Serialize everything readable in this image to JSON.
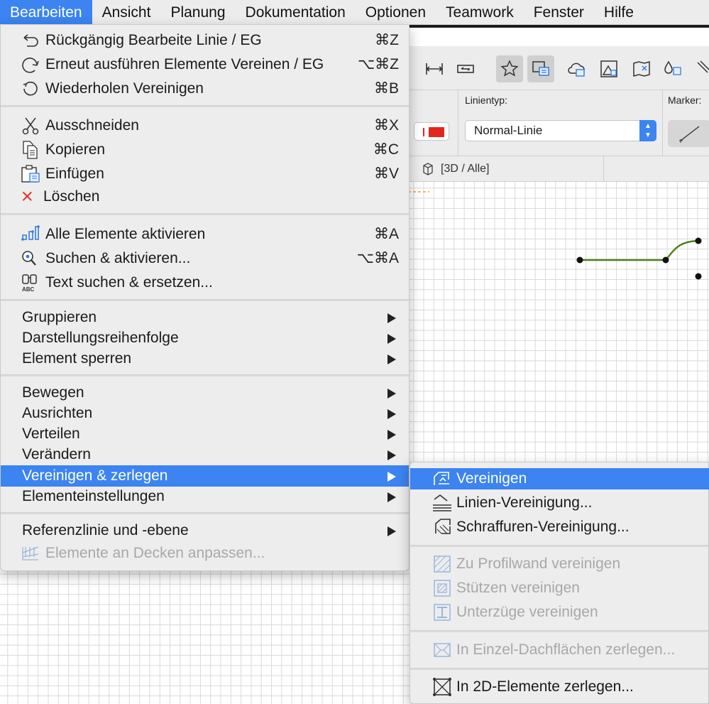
{
  "menubar": {
    "items": [
      "Bearbeiten",
      "Ansicht",
      "Planung",
      "Dokumentation",
      "Optionen",
      "Teamwork",
      "Fenster",
      "Hilfe"
    ],
    "active_index": 0
  },
  "infobox": {
    "linetype_label": "Linientyp:",
    "linetype_value": "Normal-Linie",
    "marker_label": "Marker:",
    "view_tab": "[3D / Alle]"
  },
  "edit_menu": {
    "undo": {
      "label": "Rückgängig Bearbeite Linie / EG",
      "shortcut": "⌘Z"
    },
    "redo": {
      "label": "Erneut ausführen Elemente Vereinen / EG",
      "shortcut": "⌥⌘Z"
    },
    "repeat": {
      "label": "Wiederholen Vereinigen",
      "shortcut": "⌘B"
    },
    "cut": {
      "label": "Ausschneiden",
      "shortcut": "⌘X"
    },
    "copy": {
      "label": "Kopieren",
      "shortcut": "⌘C"
    },
    "paste": {
      "label": "Einfügen",
      "shortcut": "⌘V"
    },
    "delete": {
      "label": "Löschen"
    },
    "select_all": {
      "label": "Alle Elemente aktivieren",
      "shortcut": "⌘A"
    },
    "find_select": {
      "label": "Suchen & aktivieren...",
      "shortcut": "⌥⌘A"
    },
    "find_replace": {
      "label": "Text suchen & ersetzen..."
    },
    "group": {
      "label": "Gruppieren"
    },
    "display_order": {
      "label": "Darstellungsreihenfolge"
    },
    "lock": {
      "label": "Element sperren"
    },
    "move": {
      "label": "Bewegen"
    },
    "align": {
      "label": "Ausrichten"
    },
    "distribute": {
      "label": "Verteilen"
    },
    "modify": {
      "label": "Verändern"
    },
    "merge_split": {
      "label": "Vereinigen & zerlegen"
    },
    "element_settings": {
      "label": "Elementeinstellungen"
    },
    "reference_line": {
      "label": "Referenzlinie und -ebene"
    },
    "trim_to_slabs": {
      "label": "Elemente an Decken anpassen..."
    }
  },
  "submenu": {
    "merge": "Vereinigen",
    "line_merge": "Linien-Vereinigung...",
    "hatch_merge": "Schraffuren-Vereinigung...",
    "profile_wall": "Zu Profilwand vereinigen",
    "columns": "Stützen vereinigen",
    "beams": "Unterzüge vereinigen",
    "roof_split": "In Einzel-Dachflächen zerlegen...",
    "explode_2d": "In 2D-Elemente zerlegen..."
  },
  "colors": {
    "highlight": "#3b84f1",
    "menu_bg": "#ededed",
    "disabled_text": "#a8a8a8",
    "line_green": "#4e7d1a",
    "pen_red": "#e3261c"
  }
}
